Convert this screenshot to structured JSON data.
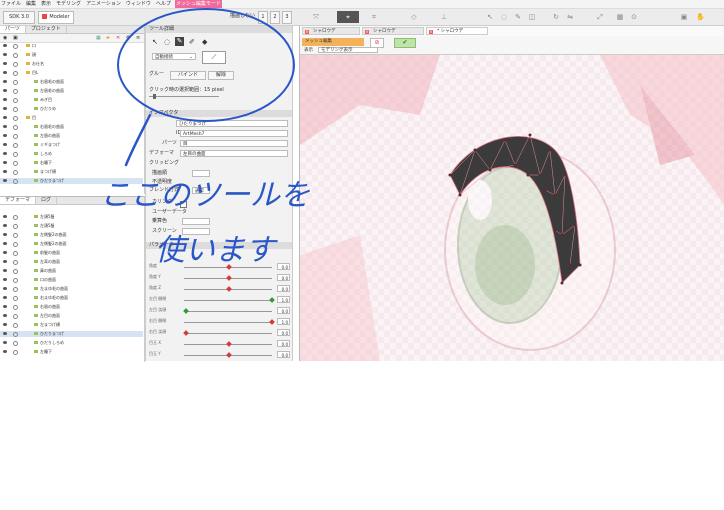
{
  "menu": [
    "ファイル",
    "編集",
    "表示",
    "モデリング",
    "アニメーション",
    "ウィンドウ",
    "ヘルプ",
    "メッシュ編集モード"
  ],
  "toolbar": {
    "sdk": "SDK 3.0",
    "modeler": "Modeler",
    "display_label": "描画しない",
    "nums": [
      "1",
      "2",
      "3"
    ]
  },
  "left_tabs": [
    "パーツ",
    "プロジェクト"
  ],
  "deformer_tabs": [
    "デフォーマ",
    "ログ"
  ],
  "layers_top": [
    {
      "label": "口",
      "type": "folder"
    },
    {
      "label": "顔",
      "type": "folder"
    },
    {
      "label": "お仕名",
      "type": "folder"
    },
    {
      "label": "目L",
      "type": "folder"
    },
    {
      "label": "右眉毛の曲面",
      "type": "mesh"
    },
    {
      "label": "左眉毛の曲面",
      "type": "mesh"
    },
    {
      "label": "みぎ目",
      "type": "mesh"
    },
    {
      "label": "ひだりめ",
      "type": "mesh"
    },
    {
      "label": "目",
      "type": "folder"
    },
    {
      "label": "右眉毛の曲面",
      "type": "mesh"
    },
    {
      "label": "左眉の曲面",
      "type": "mesh"
    },
    {
      "label": "ミギまつげ",
      "type": "mesh"
    },
    {
      "label": "しろめ",
      "type": "mesh"
    },
    {
      "label": "右瞳下",
      "type": "mesh"
    },
    {
      "label": "まつげ横",
      "type": "mesh"
    },
    {
      "label": "ひだりまつげ",
      "type": "mesh",
      "selected": true
    }
  ],
  "layers_bottom": [
    {
      "label": "左頭5髪",
      "type": "mesh"
    },
    {
      "label": "左頭5髪",
      "type": "mesh"
    },
    {
      "label": "左側髪2の曲面",
      "type": "mesh"
    },
    {
      "label": "左側髪2の曲面",
      "type": "mesh"
    },
    {
      "label": "前髪の曲面",
      "type": "mesh"
    },
    {
      "label": "左耳の曲面",
      "type": "mesh"
    },
    {
      "label": "鼻の曲面",
      "type": "mesh"
    },
    {
      "label": "口の曲面",
      "type": "mesh"
    },
    {
      "label": "左まゆ毛の曲面",
      "type": "mesh"
    },
    {
      "label": "右まゆ毛の曲面",
      "type": "mesh"
    },
    {
      "label": "右眉の曲面",
      "type": "mesh"
    },
    {
      "label": "左目の曲面",
      "type": "mesh"
    },
    {
      "label": "左まつげ横",
      "type": "mesh"
    },
    {
      "label": "ひだりまつげ",
      "type": "mesh",
      "selected": true
    },
    {
      "label": "ひだりしろめ",
      "type": "mesh"
    },
    {
      "label": "左瞳下",
      "type": "mesh"
    }
  ],
  "tool": {
    "title": "ツール詳細",
    "auto_connect": "自動接続",
    "group_label": "グルー",
    "bind": "バインド",
    "release": "解除",
    "click_range": "クリック時の選択範囲：15 pixel"
  },
  "inspector": {
    "title": "インスペクタ",
    "name": "ひだりまつげ",
    "id_label": "ID",
    "id": "ArtMesh7",
    "part_label": "パーツ",
    "part": "目",
    "deformer_label": "デフォーマ",
    "deformer": "左目の曲面",
    "clipping": "クリッピング",
    "blend_mode_label": "描画順",
    "opacity_label": "不透明度",
    "blend_label": "ブレンド方式",
    "blend_value": "通常",
    "culling_label": "カリング",
    "user_data": "ユーザーデータ",
    "multiply_label": "乗算色",
    "screen_label": "スクリーン"
  },
  "params_title": "パラメータ",
  "params": [
    {
      "label": "角度",
      "value": "0.0",
      "knob": 0.5,
      "color": "#d53a3a"
    },
    {
      "label": "角度 Y",
      "value": "0.0",
      "knob": 0.5,
      "color": "#d53a3a"
    },
    {
      "label": "角度 Z",
      "value": "0.0",
      "knob": 0.5,
      "color": "#d53a3a"
    },
    {
      "label": "左目 開閉",
      "value": "1.0",
      "knob": 1.0,
      "color": "#2e9a3a"
    },
    {
      "label": "左目 笑顔",
      "value": "0.0",
      "knob": 0.0,
      "color": "#2e9a3a"
    },
    {
      "label": "右目 開閉",
      "value": "1.0",
      "knob": 1.0,
      "color": "#d53a3a"
    },
    {
      "label": "右目 笑顔",
      "value": "0.0",
      "knob": 0.0,
      "color": "#d53a3a"
    },
    {
      "label": "目玉 X",
      "value": "0.0",
      "knob": 0.5,
      "color": "#d53a3a"
    },
    {
      "label": "目玉 Y",
      "value": "0.0",
      "knob": 0.5,
      "color": "#d53a3a"
    }
  ],
  "viewport": {
    "tabs": [
      "シャロウデ",
      "シャロウデ",
      "* シャロウデ"
    ],
    "mesh_edit": "メッシュ編集",
    "display": "表示",
    "display_value": "モデリング表示"
  },
  "annotation": {
    "text_line1": "ここのツールを",
    "text_line2": "使います",
    "color": "#2a56c8"
  }
}
